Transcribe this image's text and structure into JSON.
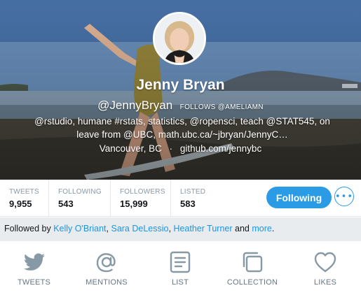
{
  "profile": {
    "name": "Jenny Bryan",
    "handle": "@JennyBryan",
    "follows_you": "FOLLOWS @AMELIAMN",
    "bio_line1": "@rstudio, humane #rstats, statistics, @ropensci, teach @STAT545, on",
    "bio_line2": "leave from @UBC, math.ubc.ca/~jbryan/JennyC…",
    "location": "Vancouver, BC",
    "separator": "·",
    "website": "github.com/jennybc"
  },
  "stats": [
    {
      "label": "TWEETS",
      "value": "9,955"
    },
    {
      "label": "FOLLOWING",
      "value": "543"
    },
    {
      "label": "FOLLOWERS",
      "value": "15,999"
    },
    {
      "label": "LISTED",
      "value": "583"
    }
  ],
  "actions": {
    "following_label": "Following",
    "more_icon": "more-dots-icon",
    "more_glyph": "•••"
  },
  "followed_by": {
    "prefix": "Followed by ",
    "users": [
      "Kelly O'Briant",
      "Sara DeLessio",
      "Heather Turner"
    ],
    "comma": ", ",
    "and": " and ",
    "more": "more",
    "period": "."
  },
  "tabs": [
    {
      "label": "TWEETS",
      "icon": "bird-icon"
    },
    {
      "label": "MENTIONS",
      "icon": "at-sign-icon"
    },
    {
      "label": "LIST",
      "icon": "list-icon"
    },
    {
      "label": "COLLECTION",
      "icon": "collection-icon"
    },
    {
      "label": "LIKES",
      "icon": "heart-icon"
    }
  ],
  "colors": {
    "accent": "#2b9be6",
    "link": "#1b95e0",
    "muted": "#8899a6",
    "tab_icon": "#657786"
  }
}
